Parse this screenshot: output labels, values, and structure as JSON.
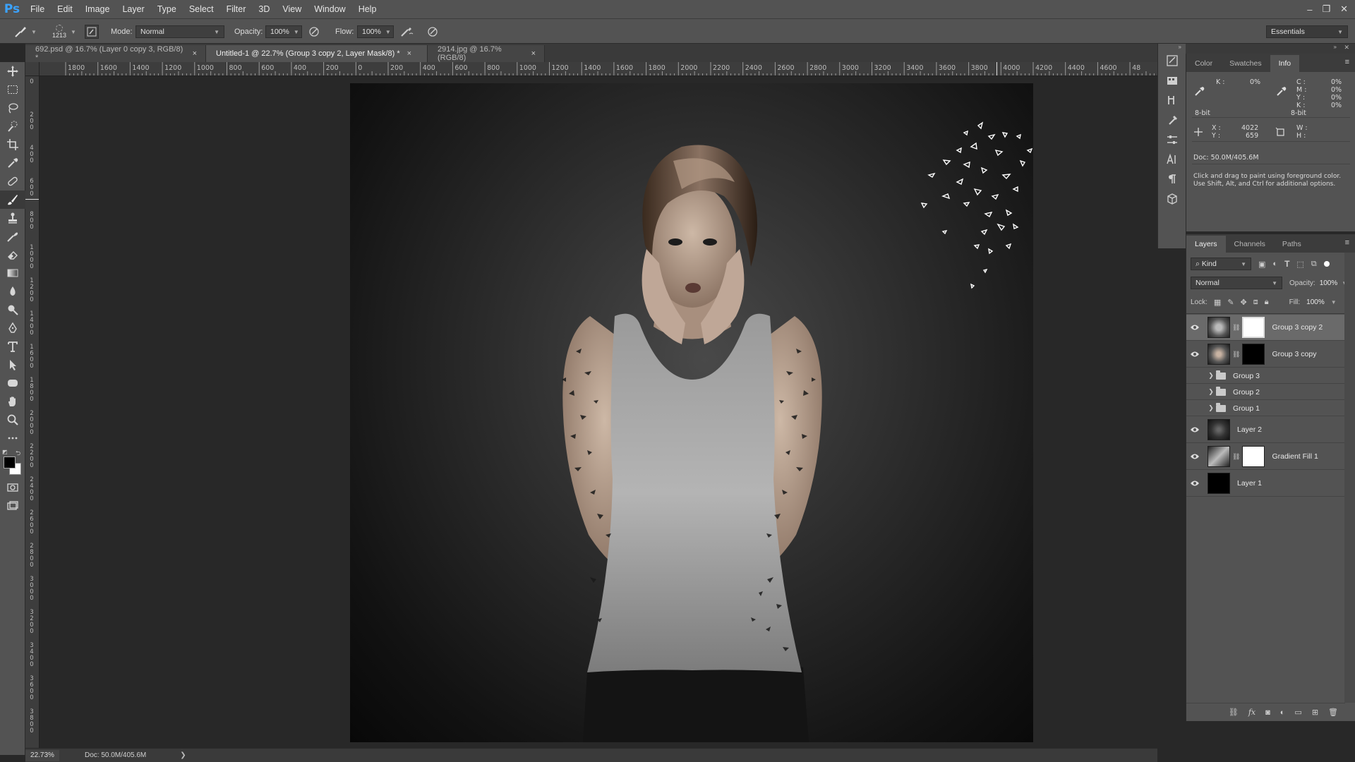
{
  "app": {
    "logo": "Ps"
  },
  "menu": [
    "File",
    "Edit",
    "Image",
    "Layer",
    "Type",
    "Select",
    "Filter",
    "3D",
    "View",
    "Window",
    "Help"
  ],
  "window_controls": {
    "minimize": "–",
    "restore": "❐",
    "close": "✕"
  },
  "options": {
    "brush_size": "1213",
    "mode_label": "Mode:",
    "mode_value": "Normal",
    "opacity_label": "Opacity:",
    "opacity_value": "100%",
    "flow_label": "Flow:",
    "flow_value": "100%",
    "workspace": "Essentials"
  },
  "tabs": [
    {
      "title": "692.psd @ 16.7% (Layer 0 copy 3, RGB/8) *",
      "close": "×",
      "active": false
    },
    {
      "title": "Untitled-1 @ 22.7% (Group 3 copy 2, Layer Mask/8) *",
      "close": "×",
      "active": true
    },
    {
      "title": "2914.jpg @ 16.7% (RGB/8)",
      "close": "×",
      "active": false
    }
  ],
  "ruler_top": [
    "1800",
    "1600",
    "1400",
    "1200",
    "1000",
    "800",
    "600",
    "400",
    "200",
    "0",
    "200",
    "400",
    "600",
    "800",
    "1000",
    "1200",
    "1400",
    "1600",
    "1800",
    "2000",
    "2200",
    "2400",
    "2600",
    "2800",
    "3000",
    "3200",
    "3400",
    "3600",
    "3800",
    "4000",
    "4200",
    "4400",
    "4600",
    "48"
  ],
  "ruler_left": [
    "0",
    "2 0 0",
    "4 0 0",
    "6 0 0",
    "8 0 0",
    "1 0 0 0",
    "1 2 0 0",
    "1 4 0 0",
    "1 6 0 0",
    "1 8 0 0",
    "2 0 0 0",
    "2 2 0 0",
    "2 4 0 0",
    "2 6 0 0",
    "2 8 0 0",
    "3 0 0 0",
    "3 2 0 0",
    "3 4 0 0",
    "3 6 0 0",
    "3 8 0 0"
  ],
  "info_panel": {
    "tabs": [
      "Color",
      "Swatches",
      "Info"
    ],
    "k_label": "K :",
    "k_value": "0%",
    "c_label": "C :",
    "c_value": "0%",
    "m_label": "M :",
    "m_value": "0%",
    "y_label": "Y :",
    "y_value": "0%",
    "k2_label": "K :",
    "k2_value": "0%",
    "bit_left": "8-bit",
    "bit_right": "8-bit",
    "x_label": "X :",
    "x_value": "4022",
    "y2_label": "Y :",
    "y2_value": "659",
    "w_label": "W :",
    "h_label": "H :",
    "doc": "Doc: 50.0M/405.6M",
    "hint_line1": "Click and drag to paint using foreground color.",
    "hint_line2": "Use Shift, Alt, and Ctrl for additional options."
  },
  "layers_panel": {
    "tabs": [
      "Layers",
      "Channels",
      "Paths"
    ],
    "filter_kind": "Kind",
    "blend_mode": "Normal",
    "opacity_label": "Opacity:",
    "opacity_value": "100%",
    "lock_label": "Lock:",
    "fill_label": "Fill:",
    "fill_value": "100%",
    "layers": [
      {
        "name": "Group 3 copy 2",
        "type": "pixel-mask",
        "visible": true,
        "selected": true
      },
      {
        "name": "Group 3 copy",
        "type": "pixel-mask",
        "visible": true,
        "selected": false
      },
      {
        "name": "Group 3",
        "type": "group",
        "visible": false,
        "selected": false
      },
      {
        "name": "Group 2",
        "type": "group",
        "visible": false,
        "selected": false
      },
      {
        "name": "Group 1",
        "type": "group",
        "visible": false,
        "selected": false
      },
      {
        "name": "Layer 2",
        "type": "pixel",
        "visible": true,
        "selected": false
      },
      {
        "name": "Gradient Fill 1",
        "type": "fill-mask",
        "visible": true,
        "selected": false
      },
      {
        "name": "Layer 1",
        "type": "pixel",
        "visible": true,
        "selected": false
      }
    ]
  },
  "status": {
    "zoom": "22.73%",
    "doc": "Doc: 50.0M/405.6M",
    "arrow": "❯"
  }
}
